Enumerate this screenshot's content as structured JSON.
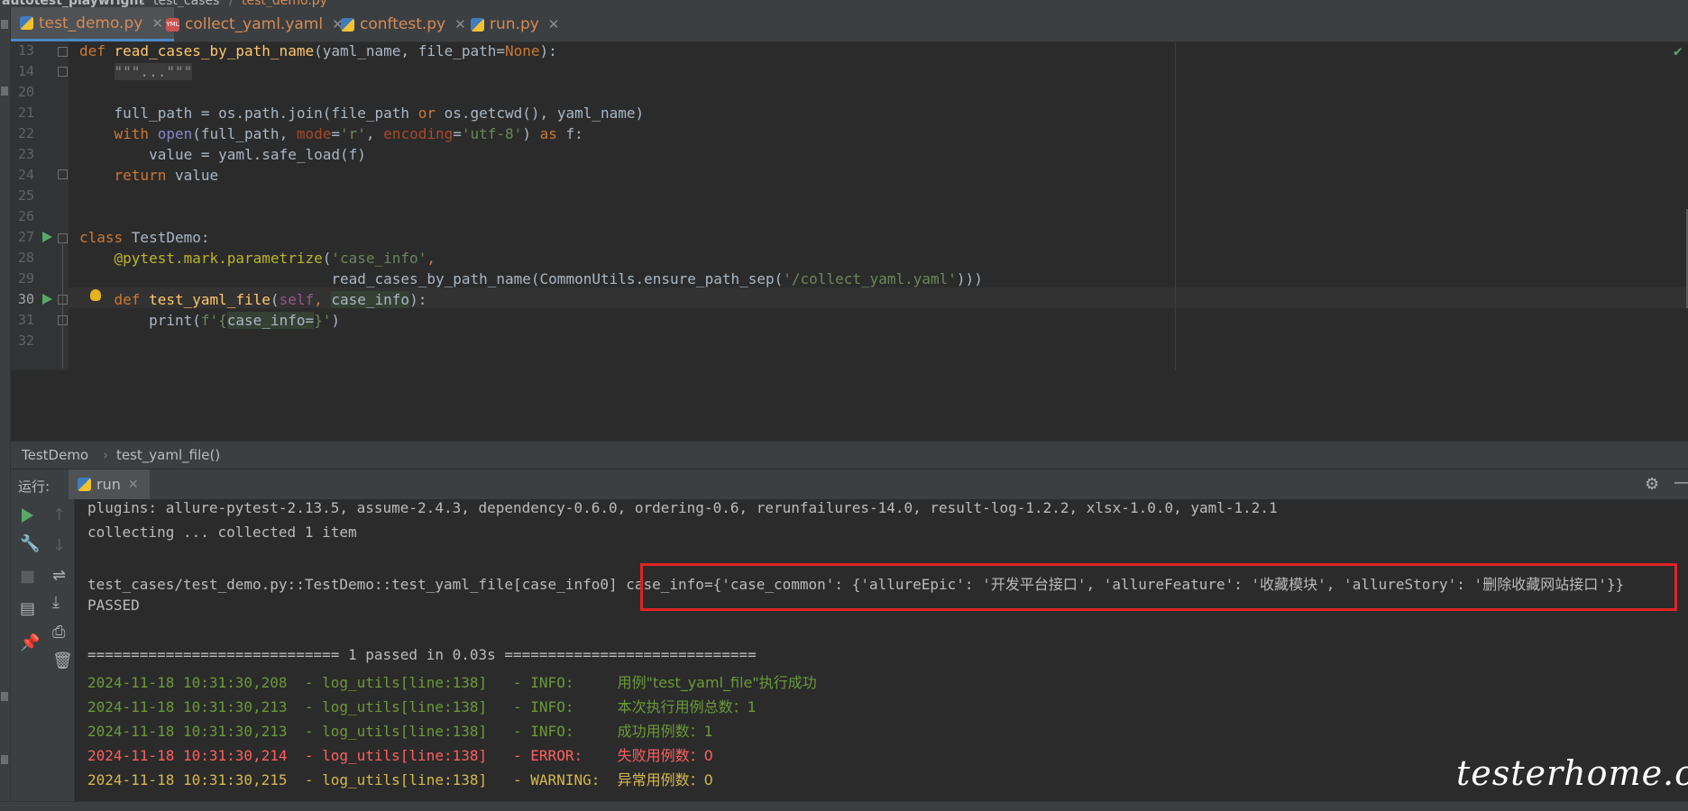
{
  "breadcrumb_top": {
    "project": "autotest_playwright",
    "folder": "test_cases",
    "file": "test_demo.py"
  },
  "tabs": [
    {
      "label": "test_demo.py",
      "icon": "python-file-icon",
      "active": true,
      "color": "#d68a57"
    },
    {
      "label": "collect_yaml.yaml",
      "icon": "yaml-file-icon",
      "active": false,
      "color": "#d68a57"
    },
    {
      "label": "conftest.py",
      "icon": "python-file-icon",
      "active": false,
      "color": "#d68a57"
    },
    {
      "label": "run.py",
      "icon": "python-file-icon",
      "active": false,
      "color": "#d68a57"
    }
  ],
  "line_numbers": [
    "13",
    "14",
    "20",
    "21",
    "22",
    "23",
    "24",
    "25",
    "26",
    "27",
    "28",
    "29",
    "30",
    "31",
    "32"
  ],
  "code_lines": {
    "l13": {
      "kw": "def ",
      "fn": "read_cases_by_path_name",
      "rest1": "(yaml_name, file_path=",
      "none": "None",
      "rest2": "):"
    },
    "l14": {
      "folded": "\"\"\"...\"\"\""
    },
    "l21": {
      "pre": "    full_path = os.path.join(file_path ",
      "kw": "or",
      "post": " os.getcwd(), yaml_name)"
    },
    "l22": {
      "kw1": "    with ",
      "fn": "open",
      "a": "(full_path, ",
      "p1": "mode",
      "b": "=",
      "s1": "'r'",
      "c": ", ",
      "p2": "encoding",
      "d": "=",
      "s2": "'utf-8'",
      "e": ") ",
      "kw2": "as",
      "f": " f:"
    },
    "l23": {
      "text": "        value = yaml.safe_load(f)"
    },
    "l24": {
      "kw": "    return",
      "rest": " value"
    },
    "l27": {
      "kw": "class ",
      "name": "TestDemo:"
    },
    "l28": {
      "dec": "    @pytest.mark.parametrize",
      "a": "(",
      "s": "'case_info'",
      "b": ","
    },
    "l29": {
      "a": "                             read_cases_by_path_name(CommonUtils.ensure_path_sep(",
      "s": "'/collect_yaml.yaml'",
      "b": ")))"
    },
    "l30": {
      "kw": "    def ",
      "fn": "test_yaml_file",
      "a": "(",
      "self": "self",
      "b": ", ",
      "hl": "case_info",
      "c": "):"
    },
    "l31": {
      "a": "        print(",
      "s1": "f'{",
      "hl": "case_info=",
      "s2": "}'",
      "b": ")"
    }
  },
  "editor_breadcrumb": {
    "class": "TestDemo",
    "method": "test_yaml_file()"
  },
  "run_window": {
    "label": "运行:",
    "tab": "run"
  },
  "console": {
    "plugins": "plugins: allure-pytest-2.13.5, assume-2.4.3, dependency-0.6.0, ordering-0.6, rerunfailures-14.0, result-log-1.2.2, xlsx-1.0.0, yaml-1.2.1",
    "collecting": "collecting ... collected 1 item",
    "test_id": "test_cases/test_demo.py::TestDemo::test_yaml_file[case_info0]",
    "case_output_a": " case_info={'case_common': {'allureEpic': '",
    "case_epic": "开发平台接口",
    "case_output_b": "', 'allureFeature': '",
    "case_feature": "收藏模块",
    "case_output_c": "', 'allureStory': '",
    "case_story": "删除收藏网站接口",
    "case_output_d": "'}}",
    "passed": "PASSED",
    "summary": "============================= 1 passed in 0.03s =============================",
    "logs": [
      {
        "ts": "2024-11-18 10:31:30,208",
        "src": "  - log_utils[line:138]",
        "level": "   - INFO:     ",
        "msg": "用例\"test_yaml_file\"执行成功",
        "color": "green"
      },
      {
        "ts": "2024-11-18 10:31:30,213",
        "src": "  - log_utils[line:138]",
        "level": "   - INFO:     ",
        "msg": "本次执行用例总数：1",
        "color": "green"
      },
      {
        "ts": "2024-11-18 10:31:30,213",
        "src": "  - log_utils[line:138]",
        "level": "   - INFO:     ",
        "msg": "成功用例数：1",
        "color": "green"
      },
      {
        "ts": "2024-11-18 10:31:30,214",
        "src": "  - log_utils[line:138]",
        "level": "   - ERROR:    ",
        "msg": "失败用例数：0",
        "color": "red"
      },
      {
        "ts": "2024-11-18 10:31:30,215",
        "src": "  - log_utils[line:138]",
        "level": "   - WARNING:  ",
        "msg": "异常用例数：0",
        "color": "yellow"
      }
    ]
  },
  "watermark": "testerhome.com"
}
